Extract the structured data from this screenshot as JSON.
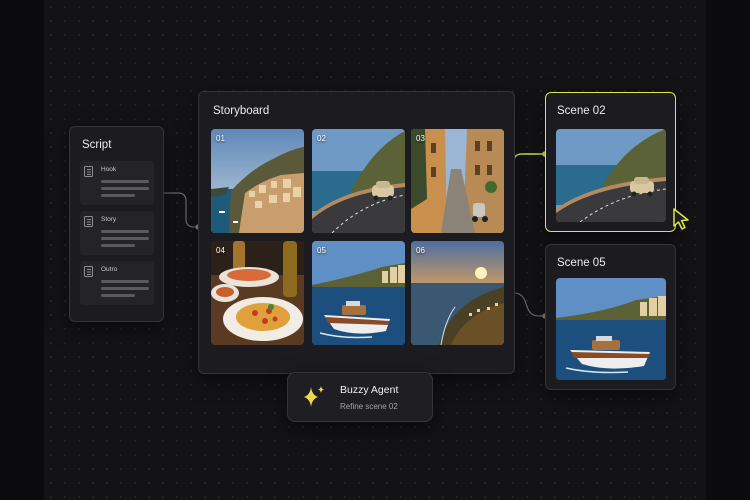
{
  "script_panel": {
    "title": "Script",
    "items": [
      {
        "label": "Hook"
      },
      {
        "label": "Story"
      },
      {
        "label": "Outro"
      }
    ]
  },
  "storyboard": {
    "title": "Storyboard",
    "frames": [
      {
        "number": "01",
        "subject": "coastal cliff village"
      },
      {
        "number": "02",
        "subject": "coastal road with vintage car"
      },
      {
        "number": "03",
        "subject": "narrow village street with scooter"
      },
      {
        "number": "04",
        "subject": "spaghetti pasta on table"
      },
      {
        "number": "05",
        "subject": "wooden motorboat on sea"
      },
      {
        "number": "06",
        "subject": "sunset over coastline"
      }
    ]
  },
  "scenes": [
    {
      "title": "Scene 02",
      "selected": true
    },
    {
      "title": "Scene 05",
      "selected": false
    }
  ],
  "agent": {
    "name": "Buzzy Agent",
    "subtitle": "Refine scene 02",
    "icon": "sparkle-icon"
  },
  "colors": {
    "accent": "#d8e84a",
    "canvas": "#131316",
    "card": "#1c1c20"
  }
}
